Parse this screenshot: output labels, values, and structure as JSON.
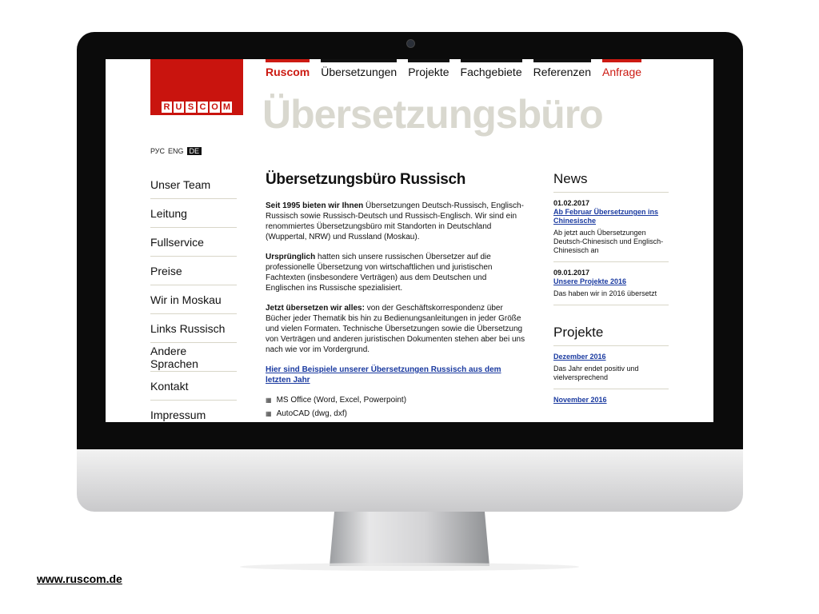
{
  "site": {
    "logo_text": "RUSCOM",
    "big_title": "Übersetzungsbüro",
    "nav": [
      {
        "label": "Ruscom",
        "active": true
      },
      {
        "label": "Übersetzungen"
      },
      {
        "label": "Projekte"
      },
      {
        "label": "Fachgebiete"
      },
      {
        "label": "Referenzen"
      },
      {
        "label": "Anfrage"
      }
    ],
    "lang": [
      "РУС",
      "ENG",
      "DE"
    ],
    "sidebar": [
      "Unser Team",
      "Leitung",
      "Fullservice",
      "Preise",
      "Wir in Moskau",
      "Links Russisch",
      "Andere Sprachen",
      "Kontakt",
      "Impressum"
    ]
  },
  "main": {
    "heading": "Übersetzungsbüro Russisch",
    "p1_bold": "Seit 1995 bieten wir Ihnen",
    "p1_text": " Übersetzungen Deutsch-Russisch, Englisch-Russisch sowie Russisch-Deutsch und Russisch-Englisch. Wir sind ein renommiertes Übersetzungsbüro mit Standorten in Deutschland (Wuppertal, NRW) und Russland (Moskau).",
    "p2_bold": "Ursprünglich",
    "p2_text": " hatten sich unsere russischen Übersetzer auf die professionelle Übersetzung von wirtschaftlichen und juristischen Fachtexten (insbesondere Verträgen) aus dem Deutschen und Englischen ins Russische spezialisiert.",
    "p3_bold": "Jetzt übersetzen wir alles:",
    "p3_text": " von der Geschäftskorrespondenz über Bücher jeder Thematik bis hin zu Bedienungsanleitungen in jeder Größe und vielen Formaten. Technische Übersetzungen sowie die Übersetzung von Verträgen und anderen juristischen Dokumenten stehen aber bei uns nach wie vor im Vordergrund.",
    "link": "Hier sind Beispiele unserer Übersetzungen Russisch aus dem letzten Jahr",
    "list": [
      "MS Office (Word, Excel, Powerpoint)",
      "AutoCAD (dwg, dxf)"
    ]
  },
  "news": {
    "heading": "News",
    "items": [
      {
        "date": "01.02.2017",
        "link": "Ab Februar Übersetzungen ins Chinesische",
        "text": "Ab jetzt auch Übersetzungen Deutsch-Chinesisch und Englisch-Chinesisch an"
      },
      {
        "date": "09.01.2017",
        "link": "Unsere Projekte 2016",
        "text": "Das haben wir in 2016 übersetzt"
      }
    ]
  },
  "projects": {
    "heading": "Projekte",
    "items": [
      {
        "link": "Dezember 2016",
        "text": "Das Jahr endet positiv und vielversprechend"
      },
      {
        "link": "November 2016",
        "text": ""
      }
    ]
  },
  "caption": "www.ruscom.de",
  "colors": {
    "brand_red": "#c9140e",
    "link_blue": "#1a3aa0",
    "title_gray": "#d9d8cf"
  }
}
